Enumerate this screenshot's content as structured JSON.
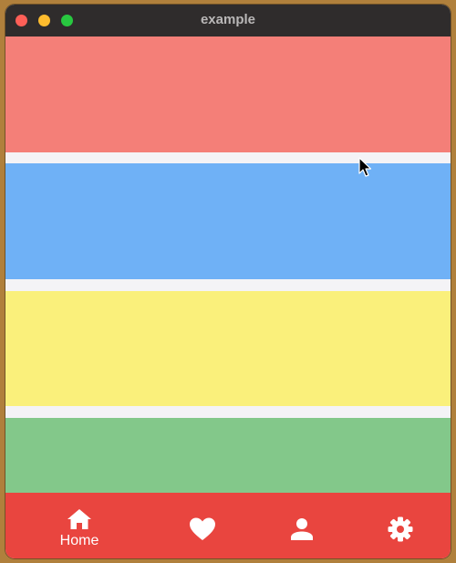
{
  "window": {
    "title": "example"
  },
  "colors": {
    "titlebar": "#2f2c2c",
    "block_1": "#f47f78",
    "block_2": "#6fb1f6",
    "block_3": "#faf07b",
    "block_4": "#83c88a",
    "navbar": "#e9453f",
    "nav_icon": "#ffffff"
  },
  "nav": {
    "items": [
      {
        "icon": "home-icon",
        "label": "Home",
        "selected": true
      },
      {
        "icon": "heart-icon",
        "label": "",
        "selected": false
      },
      {
        "icon": "person-icon",
        "label": "",
        "selected": false
      },
      {
        "icon": "gear-icon",
        "label": "",
        "selected": false
      }
    ]
  }
}
